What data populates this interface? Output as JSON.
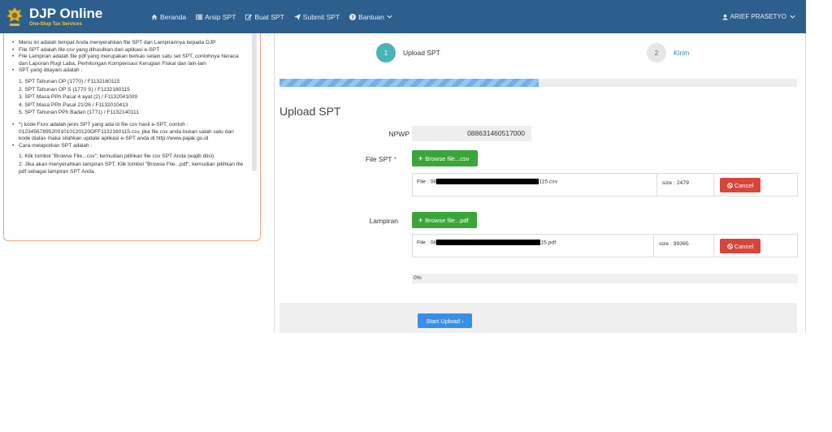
{
  "colors": {
    "navbar_bg": "#2c5f8d",
    "accent_teal": "#4ab3b5",
    "btn_green": "#3aa63a",
    "btn_red": "#d9453a",
    "btn_blue": "#3a8ee6",
    "info_border": "#f0a57c"
  },
  "brand": {
    "title": "DJP Online",
    "subtitle": "One-Stop Tax Services",
    "logo_icon": "djp-emblem-icon"
  },
  "nav": {
    "items": [
      {
        "label": "Beranda",
        "icon": "home-icon"
      },
      {
        "label": "Arsip SPT",
        "icon": "list-icon"
      },
      {
        "label": "Buat SPT",
        "icon": "edit-icon"
      },
      {
        "label": "Submit SPT",
        "icon": "send-icon"
      },
      {
        "label": "Bantuan",
        "icon": "question-circle-icon"
      }
    ],
    "user": "ARIEF PRASETYO"
  },
  "info": {
    "bullets_top": [
      "Menu ini adalah tempat Anda menyerahkan file SPT dan Lampirannya kepada DJP",
      "File SPT adalah file csv yang dihasilkan dari aplikasi e-SPT",
      "File Lampiran adalah file pdf yang merupakan berkas selain satu set SPT, contohnya Neraca dan Laporan Rugi Laba, Perhitungan Kompensasi Kerugian Fiskal dan lain-lain",
      "SPT yang dilayani adalah :"
    ],
    "spt_list": [
      "1.   SPT Tahunan OP (1770) / F1132160115",
      "2.   SPT Tahunan OP S (1770 S) / F1132180115",
      "3.   SPT Masa PPh Pasal 4 ayat (2) / F1132041009",
      "4.   SPT Masa PPh Pasal 21/26 / F1132010413",
      "5.   SPT Tahunan PPh Badan (1771) / F1132140111"
    ],
    "note": "*) kode Fxxx adalah jenis SPT yang ada di file csv hasil e-SPT, contoh : 012345678952001010120120OFF1132160115.csv, jika file csv anda bukan salah satu dari kode diatas maka silahkan update aplikasi e-SPT anda di http://www.pajak.go.id",
    "how_title": "Cara melaporkan SPT adalah :",
    "how_list": [
      "1.   Klik tombol \"Browse File...csv\", kemudian pilihkan file csv SPT Anda (wajib diisi)",
      "2.   Jika akan menyerahkan lampiran SPT, Klik tombol \"Browse File...pdf\", kemudian pilihkan file pdf sebagai lampiran SPT Anda"
    ]
  },
  "steps": [
    {
      "number": "1",
      "label": "Upload SPT"
    },
    {
      "number": "2",
      "label": "Kirim"
    }
  ],
  "upload_progress_fraction": 0.5,
  "form": {
    "title": "Upload SPT",
    "npwp_label": "NPWP",
    "npwp_value": "088631460517000",
    "file_spt_label": "File SPT",
    "required_mark": "*",
    "browse_csv": "Browse file...csv",
    "csv_file_prefix": "File : 08",
    "csv_file_suffix": "115.csv",
    "csv_size": "size : 2479",
    "cancel": "Cancel",
    "lampiran_label": "Lampiran",
    "browse_pdf": "Browse file...pdf",
    "pdf_file_prefix": "File : 08",
    "pdf_file_suffix": "15.pdf",
    "pdf_size": "size : 99365",
    "progress_text": "0%",
    "start_upload": "Start Upload ›"
  }
}
